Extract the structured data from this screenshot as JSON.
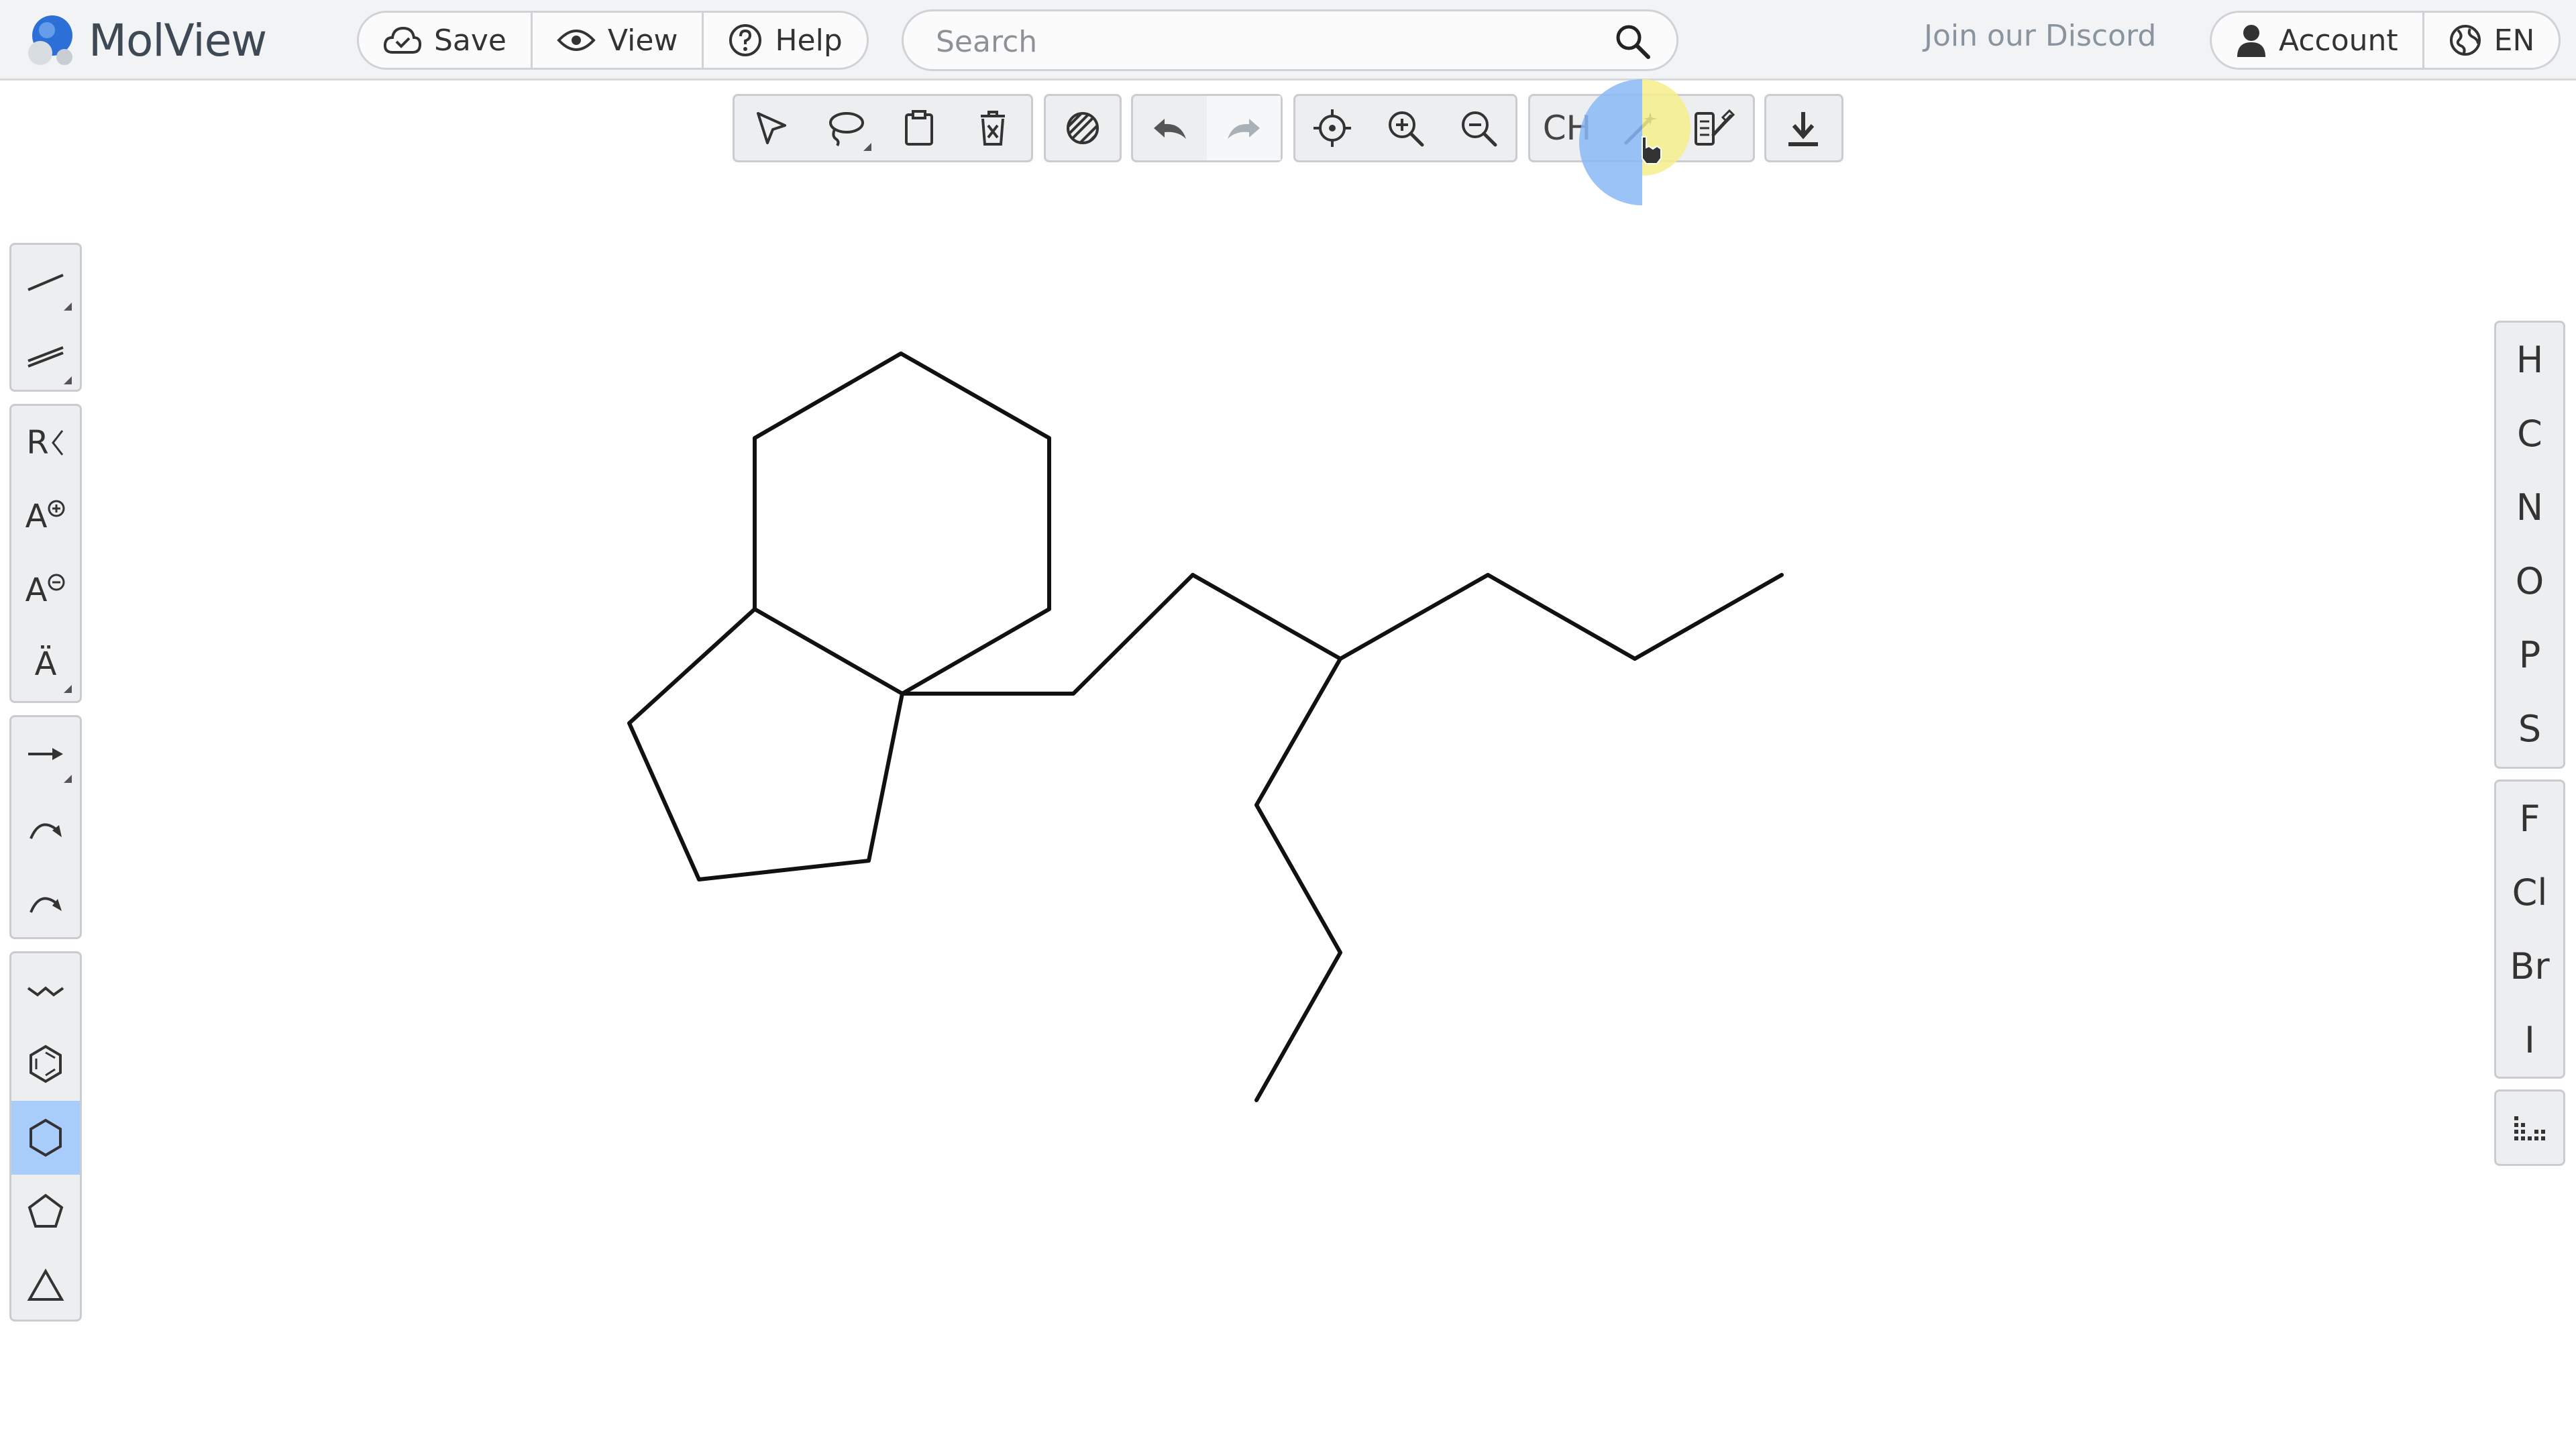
{
  "app": {
    "name": "MolView"
  },
  "header": {
    "save_label": "Save",
    "view_label": "View",
    "help_label": "Help",
    "search_placeholder": "Search",
    "discord_label": "Join our Discord",
    "account_label": "Account",
    "language_label": "EN"
  },
  "toolbar": {
    "tools": [
      "select-icon",
      "lasso-icon",
      "clipboard-icon",
      "erase-icon",
      "hatch-icon",
      "undo-icon",
      "redo-icon",
      "center-icon",
      "zoom-in-icon",
      "zoom-out-icon",
      "magic-wand-icon",
      "clean-structure-icon",
      "download-icon"
    ],
    "ch_label": "CH"
  },
  "left_toolbar": {
    "r_group_label": "R",
    "charge_plus_label": "A",
    "charge_minus_label": "A",
    "radical_label": "Ä",
    "active_tool": "hexagon-ring"
  },
  "elements": {
    "main": [
      "H",
      "C",
      "N",
      "O",
      "P",
      "S"
    ],
    "halogens": [
      "F",
      "Cl",
      "Br",
      "I"
    ]
  },
  "colors": {
    "accent_blue": "#a9cdfa",
    "cursor_highlight_blue": "#8ab8f7",
    "cursor_highlight_yellow": "#f6ee8a",
    "toolbar_bg": "#eceeef",
    "header_bg": "#f2f3f4"
  }
}
